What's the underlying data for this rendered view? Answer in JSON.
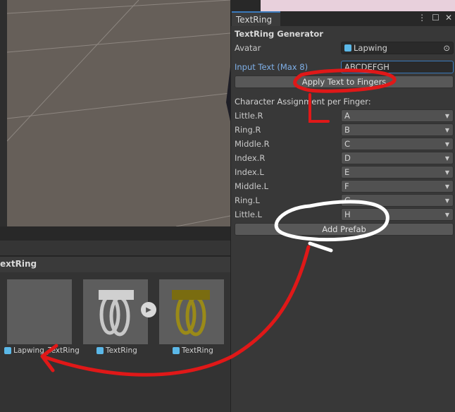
{
  "inspector": {
    "tab": "TextRing",
    "title": "TextRing Generator",
    "avatar_label": "Avatar",
    "avatar_value": "Lapwing",
    "input_label": "Input Text (Max 8)",
    "input_value": "ABCDEFGH",
    "apply_button": "Apply Text to Fingers",
    "assign_header": "Character Assignment per Finger:",
    "fingers": [
      {
        "label": "Little.R",
        "value": "A"
      },
      {
        "label": "Ring.R",
        "value": "B"
      },
      {
        "label": "Middle.R",
        "value": "C"
      },
      {
        "label": "Index.R",
        "value": "D"
      },
      {
        "label": "Index.L",
        "value": "E"
      },
      {
        "label": "Middle.L",
        "value": "F"
      },
      {
        "label": "Ring.L",
        "value": "G"
      },
      {
        "label": "Little.L",
        "value": "H"
      }
    ],
    "add_prefab_button": "Add Prefab"
  },
  "project": {
    "folder": "extRing",
    "assets": [
      {
        "name": "Lapwing_TextRing"
      },
      {
        "name": "TextRing"
      },
      {
        "name": "TextRing"
      }
    ]
  },
  "colors": {
    "accent": "#3a79bb",
    "annotation_red": "#e01818",
    "label_blue": "#7fb0e8"
  }
}
